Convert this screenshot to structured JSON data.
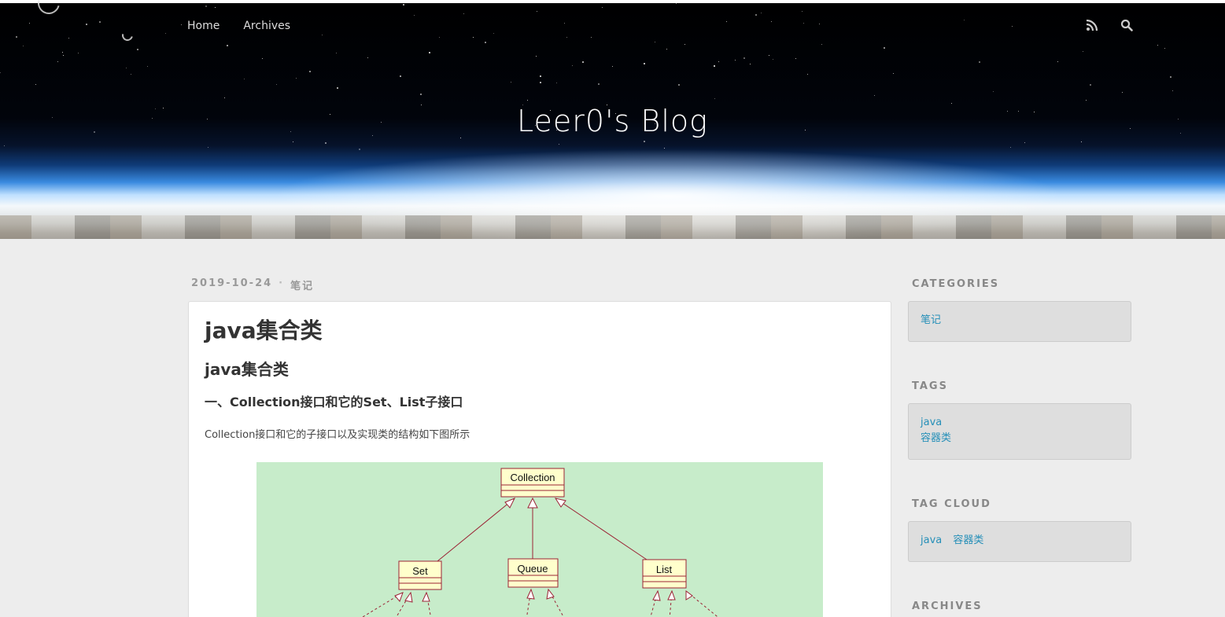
{
  "site": {
    "title": "Leer0's Blog",
    "nav": [
      {
        "label": "Home"
      },
      {
        "label": "Archives"
      }
    ],
    "icons": [
      "rss-icon",
      "search-icon"
    ]
  },
  "article": {
    "date": "2019-10-24",
    "separator": "·",
    "category": "笔记",
    "title": "java集合类",
    "h2": "java集合类",
    "h3": "一、Collection接口和它的Set、List子接口",
    "paragraph": "Collection接口和它的子接口以及实现类的结构如下图所示",
    "diagram": {
      "nodes": {
        "collection": "Collection",
        "set": "Set",
        "queue": "Queue",
        "list": "List"
      },
      "background": "#c7ecca",
      "box_fill": "#ffffcc",
      "line_color": "#9b2335"
    }
  },
  "sidebar": {
    "categories": {
      "title": "CATEGORIES",
      "items": [
        "笔记"
      ]
    },
    "tags": {
      "title": "TAGS",
      "items": [
        "java",
        "容器类"
      ]
    },
    "tag_cloud": {
      "title": "TAG CLOUD",
      "items": [
        "java",
        "容器类"
      ]
    },
    "archives": {
      "title": "ARCHIVES"
    }
  },
  "colors": {
    "link": "#258fb8",
    "page_background": "#ededed"
  }
}
